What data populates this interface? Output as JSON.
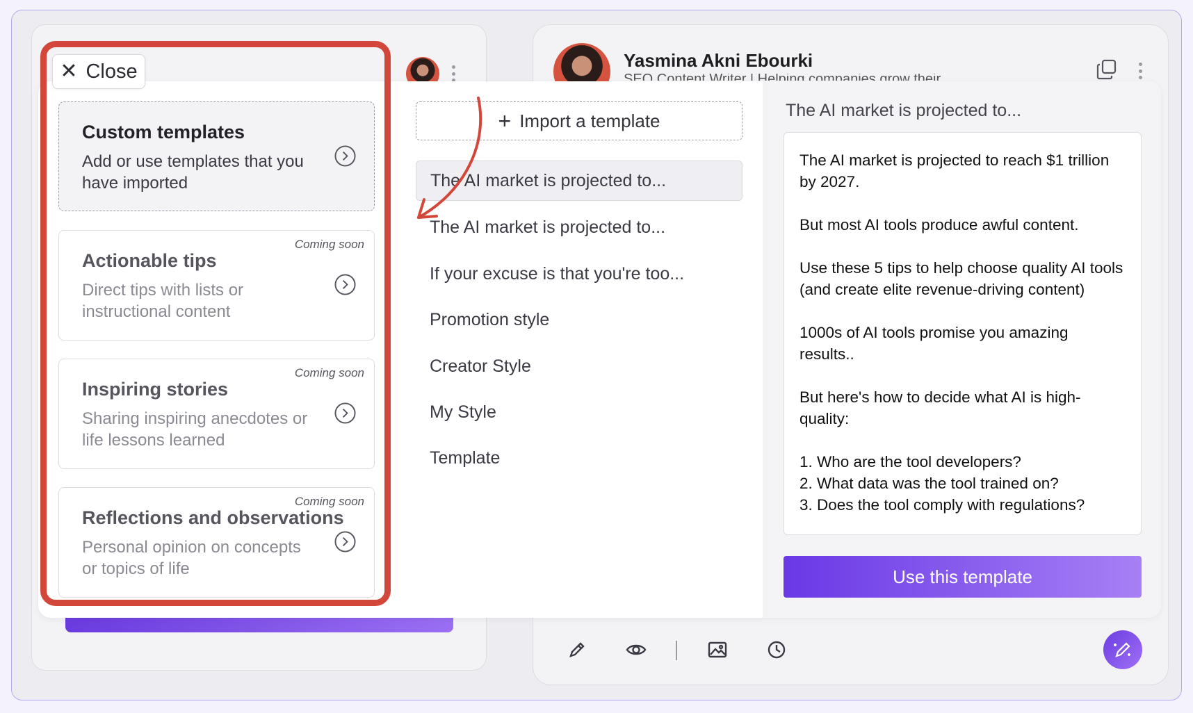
{
  "profile": {
    "name": "Yasmina Akni Ebourki",
    "subtitle": "SEO Content Writer | Helping companies grow their content"
  },
  "close": {
    "label": "Close"
  },
  "categories": [
    {
      "title": "Custom templates",
      "desc": "Add or use templates that you have imported",
      "badge": ""
    },
    {
      "title": "Actionable tips",
      "desc": "Direct tips with lists or instructional content",
      "badge": "Coming soon"
    },
    {
      "title": "Inspiring stories",
      "desc": "Sharing inspiring anecdotes or life lessons learned",
      "badge": "Coming soon"
    },
    {
      "title": "Reflections and observations",
      "desc": "Personal opinion on concepts or topics of life",
      "badge": "Coming soon"
    }
  ],
  "import": {
    "label": "Import a template"
  },
  "templates": [
    "The AI market is projected to...",
    "The AI market is projected to...",
    "If your excuse is that you're too...",
    "Promotion style",
    "Creator Style",
    "My Style",
    "Template"
  ],
  "preview": {
    "title": "The AI market is projected to...",
    "paragraphs": [
      "The AI market is projected to reach $1 trillion by 2027.",
      "But most AI tools produce awful content.",
      "Use these 5 tips to help choose quality AI tools (and create elite revenue-driving content)",
      "1000s of AI tools promise you amazing results..",
      "But here's how to decide what AI is high-quality:"
    ],
    "list": [
      "1. Who are the tool developers?",
      "2. What data was the tool trained on?",
      "3. Does the tool comply with regulations?"
    ]
  },
  "use_button": {
    "label": "Use this template"
  },
  "colors": {
    "accent": "#6a38e6",
    "highlight": "#d2473a"
  }
}
